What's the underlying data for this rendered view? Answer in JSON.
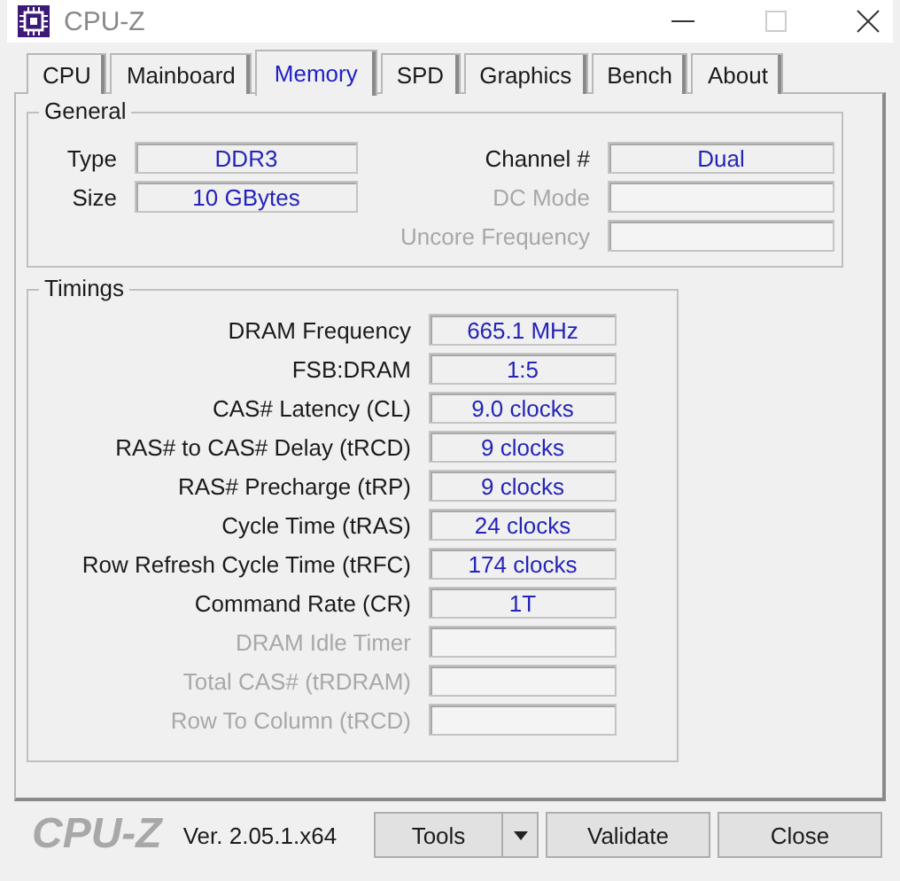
{
  "window": {
    "title": "CPU-Z"
  },
  "tabs": [
    {
      "label": "CPU",
      "selected": false
    },
    {
      "label": "Mainboard",
      "selected": false
    },
    {
      "label": "Memory",
      "selected": true
    },
    {
      "label": "SPD",
      "selected": false
    },
    {
      "label": "Graphics",
      "selected": false
    },
    {
      "label": "Bench",
      "selected": false
    },
    {
      "label": "About",
      "selected": false
    }
  ],
  "general": {
    "title": "General",
    "left": [
      {
        "label": "Type",
        "value": "DDR3",
        "disabled": false
      },
      {
        "label": "Size",
        "value": "10 GBytes",
        "disabled": false
      }
    ],
    "right": [
      {
        "label": "Channel #",
        "value": "Dual",
        "disabled": false
      },
      {
        "label": "DC Mode",
        "disabled": true
      },
      {
        "label": "Uncore Frequency",
        "disabled": true
      }
    ]
  },
  "timings": {
    "title": "Timings",
    "rows": [
      {
        "label": "DRAM Frequency",
        "value": "665.1 MHz",
        "disabled": false
      },
      {
        "label": "FSB:DRAM",
        "value": "1:5",
        "disabled": false
      },
      {
        "label": "CAS# Latency (CL)",
        "value": "9.0 clocks",
        "disabled": false
      },
      {
        "label": "RAS# to CAS# Delay (tRCD)",
        "value": "9 clocks",
        "disabled": false
      },
      {
        "label": "RAS# Precharge (tRP)",
        "value": "9 clocks",
        "disabled": false
      },
      {
        "label": "Cycle Time (tRAS)",
        "value": "24 clocks",
        "disabled": false
      },
      {
        "label": "Row Refresh Cycle Time (tRFC)",
        "value": "174 clocks",
        "disabled": false
      },
      {
        "label": "Command Rate (CR)",
        "value": "1T",
        "disabled": false
      },
      {
        "label": "DRAM Idle Timer",
        "disabled": true
      },
      {
        "label": "Total CAS# (tRDRAM)",
        "disabled": true
      },
      {
        "label": "Row To Column (tRCD)",
        "disabled": true
      }
    ]
  },
  "footer": {
    "logo": "CPU-Z",
    "version": "Ver. 2.05.1.x64",
    "buttons": [
      {
        "label": "Tools",
        "kind": "split"
      },
      {
        "label": "Validate",
        "kind": "plain"
      },
      {
        "label": "Close",
        "kind": "plain"
      }
    ]
  }
}
